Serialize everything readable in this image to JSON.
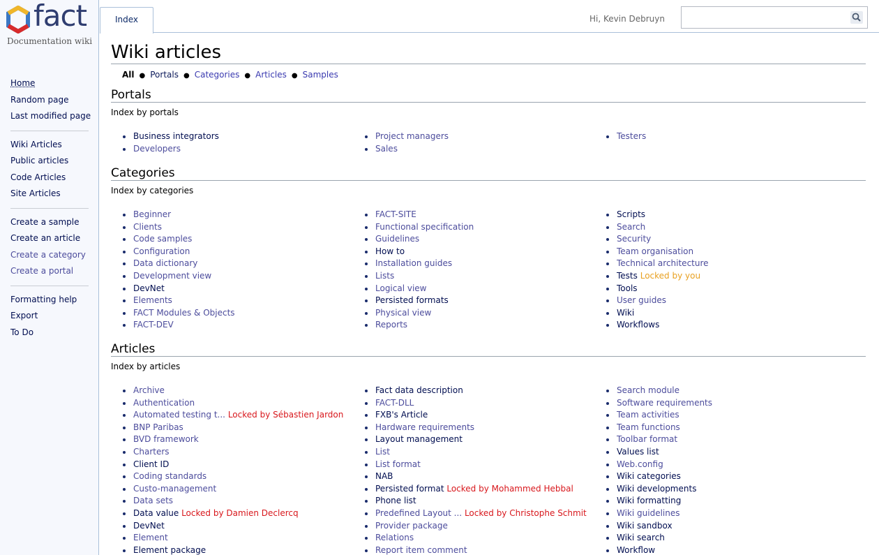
{
  "app": {
    "logo_text": "fact",
    "subtitle": "Documentation wiki",
    "brand_colors": [
      "#3b78c4",
      "#d82b2b",
      "#f0b62a",
      "#2f3d70"
    ]
  },
  "topbar": {
    "tab_label": "Index",
    "greeting": "Hi, Kevin Debruyn",
    "search": {
      "value": "",
      "placeholder": "",
      "icon": "search-icon"
    }
  },
  "sidebar": {
    "groups": [
      [
        {
          "label": "Home",
          "style": "home"
        },
        {
          "label": "Random page",
          "style": "dark"
        },
        {
          "label": "Last modified page",
          "style": "dark"
        }
      ],
      [
        {
          "label": "Wiki Articles",
          "style": "dark"
        },
        {
          "label": "Public articles",
          "style": "dark"
        },
        {
          "label": "Code Articles",
          "style": "dark"
        },
        {
          "label": "Site Articles",
          "style": "dark"
        }
      ],
      [
        {
          "label": "Create a sample",
          "style": "dark"
        },
        {
          "label": "Create an article",
          "style": "dark"
        },
        {
          "label": "Create a category",
          "style": "purple"
        },
        {
          "label": "Create a portal",
          "style": "purple"
        }
      ],
      [
        {
          "label": "Formatting help",
          "style": "dark"
        },
        {
          "label": "Export",
          "style": "dark"
        },
        {
          "label": "To Do",
          "style": "dark"
        }
      ]
    ]
  },
  "page": {
    "title": "Wiki articles",
    "subnav": [
      "All",
      "Portals",
      "Categories",
      "Articles",
      "Samples"
    ]
  },
  "portals": {
    "title": "Portals",
    "desc": "Index by portals",
    "columns": [
      [
        {
          "t": "Business integrators",
          "s": "dk"
        },
        {
          "t": "Developers",
          "s": "lnk"
        }
      ],
      [
        {
          "t": "Project managers",
          "s": "lnk"
        },
        {
          "t": "Sales",
          "s": "lnk"
        }
      ],
      [
        {
          "t": "Testers",
          "s": "lnk"
        }
      ]
    ]
  },
  "categories": {
    "title": "Categories",
    "desc": "Index by categories",
    "columns": [
      [
        {
          "t": "Beginner",
          "s": "lnk"
        },
        {
          "t": "Clients",
          "s": "lnk"
        },
        {
          "t": "Code samples",
          "s": "lnk"
        },
        {
          "t": "Configuration",
          "s": "lnk"
        },
        {
          "t": "Data dictionary",
          "s": "lnk"
        },
        {
          "t": "Development view",
          "s": "lnk"
        },
        {
          "t": "DevNet",
          "s": "dk"
        },
        {
          "t": "Elements",
          "s": "lnk"
        },
        {
          "t": "FACT Modules & Objects",
          "s": "lnk"
        },
        {
          "t": "FACT-DEV",
          "s": "lnk"
        }
      ],
      [
        {
          "t": "FACT-SITE",
          "s": "lnk"
        },
        {
          "t": "Functional specification",
          "s": "lnk"
        },
        {
          "t": "Guidelines",
          "s": "lnk"
        },
        {
          "t": "How to",
          "s": "dk"
        },
        {
          "t": "Installation guides",
          "s": "lnk"
        },
        {
          "t": "Lists",
          "s": "lnk"
        },
        {
          "t": "Logical view",
          "s": "lnk"
        },
        {
          "t": "Persisted formats",
          "s": "dk"
        },
        {
          "t": "Physical view",
          "s": "lnk"
        },
        {
          "t": "Reports",
          "s": "lnk"
        }
      ],
      [
        {
          "t": "Scripts",
          "s": "dk"
        },
        {
          "t": "Search",
          "s": "lnk"
        },
        {
          "t": "Security",
          "s": "lnk"
        },
        {
          "t": "Team organisation",
          "s": "lnk"
        },
        {
          "t": "Technical architecture",
          "s": "lnk"
        },
        {
          "t": "Tests",
          "s": "dk",
          "lock": "Locked by you",
          "lock_style": "lock-orange"
        },
        {
          "t": "Tools",
          "s": "dk"
        },
        {
          "t": "User guides",
          "s": "lnk"
        },
        {
          "t": "Wiki",
          "s": "dk"
        },
        {
          "t": "Workflows",
          "s": "dk"
        }
      ]
    ]
  },
  "articles": {
    "title": "Articles",
    "desc": "Index by articles",
    "columns": [
      [
        {
          "t": "Archive",
          "s": "lnk"
        },
        {
          "t": "Authentication",
          "s": "lnk"
        },
        {
          "t": "Automated testing t...",
          "s": "lnk",
          "lock": "Locked by Sébastien Jardon",
          "lock_style": "lock-red"
        },
        {
          "t": "BNP Paribas",
          "s": "lnk"
        },
        {
          "t": "BVD framework",
          "s": "lnk"
        },
        {
          "t": "Charters",
          "s": "lnk"
        },
        {
          "t": "Client ID",
          "s": "dk"
        },
        {
          "t": "Coding standards",
          "s": "lnk"
        },
        {
          "t": "Custo-management",
          "s": "lnk"
        },
        {
          "t": "Data sets",
          "s": "lnk"
        },
        {
          "t": "Data value",
          "s": "dk",
          "lock": "Locked by Damien Declercq",
          "lock_style": "lock-red"
        },
        {
          "t": "DevNet",
          "s": "dk"
        },
        {
          "t": "Element",
          "s": "lnk"
        },
        {
          "t": "Element package",
          "s": "dk"
        }
      ],
      [
        {
          "t": "Fact data description",
          "s": "dk"
        },
        {
          "t": "FACT-DLL",
          "s": "lnk"
        },
        {
          "t": "FXB's Article",
          "s": "dk"
        },
        {
          "t": "Hardware requirements",
          "s": "lnk"
        },
        {
          "t": "Layout management",
          "s": "dk"
        },
        {
          "t": "List",
          "s": "lnk"
        },
        {
          "t": "List format",
          "s": "lnk"
        },
        {
          "t": "NAB",
          "s": "dk"
        },
        {
          "t": "Persisted format",
          "s": "dk",
          "lock": "Locked by Mohammed Hebbal",
          "lock_style": "lock-red"
        },
        {
          "t": "Phone list",
          "s": "dk"
        },
        {
          "t": "Predefined Layout ...",
          "s": "lnk",
          "lock": "Locked by Christophe Schmit",
          "lock_style": "lock-red"
        },
        {
          "t": "Provider package",
          "s": "lnk"
        },
        {
          "t": "Relations",
          "s": "lnk"
        },
        {
          "t": "Report item comment",
          "s": "lnk"
        }
      ],
      [
        {
          "t": "Search module",
          "s": "lnk"
        },
        {
          "t": "Software requirements",
          "s": "lnk"
        },
        {
          "t": "Team activities",
          "s": "lnk"
        },
        {
          "t": "Team functions",
          "s": "lnk"
        },
        {
          "t": "Toolbar format",
          "s": "lnk"
        },
        {
          "t": "Values list",
          "s": "dk"
        },
        {
          "t": "Web.config",
          "s": "lnk"
        },
        {
          "t": "Wiki categories",
          "s": "dk"
        },
        {
          "t": "Wiki developments",
          "s": "dk"
        },
        {
          "t": "Wiki formatting",
          "s": "dk"
        },
        {
          "t": "Wiki guidelines",
          "s": "lnk"
        },
        {
          "t": "Wiki sandbox",
          "s": "dk"
        },
        {
          "t": "Wiki search",
          "s": "dk"
        },
        {
          "t": "Workflow",
          "s": "dk"
        }
      ]
    ]
  }
}
